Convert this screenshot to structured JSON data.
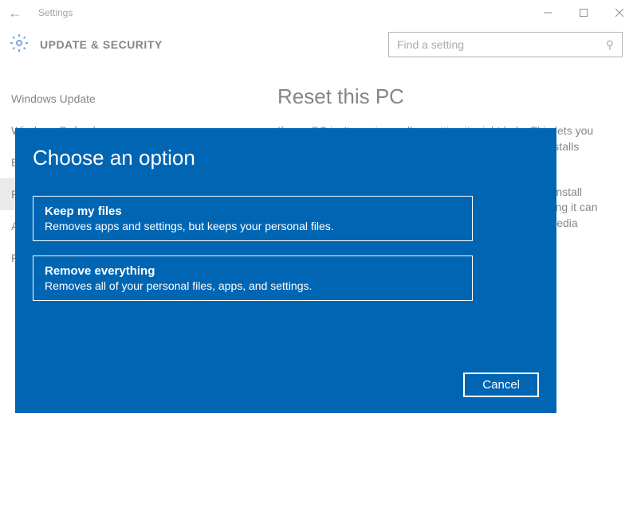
{
  "titlebar": {
    "title": "Settings"
  },
  "header": {
    "title": "UPDATE & SECURITY",
    "search_placeholder": "Find a setting"
  },
  "sidebar": {
    "items": [
      {
        "label": "Windows Update"
      },
      {
        "label": "Windows Defender"
      },
      {
        "label": "Backup"
      },
      {
        "label": "Recovery"
      },
      {
        "label": "Activation"
      },
      {
        "label": "For developers"
      }
    ]
  },
  "main": {
    "heading": "Reset this PC",
    "para1": "If your PC isn't running well, resetting it might help. This lets you choose to keep your files or remove them, and then reinstalls Windows.",
    "para2": "If you want to recycle your PC or start over with a clean install (using installation media like a disc or USB DVD), resetting it can help. You can change the startup settings to boot from media instead. This will"
  },
  "dialog": {
    "title": "Choose an option",
    "options": [
      {
        "title": "Keep my files",
        "desc": "Removes apps and settings, but keeps your personal files."
      },
      {
        "title": "Remove everything",
        "desc": "Removes all of your personal files, apps, and settings."
      }
    ],
    "cancel": "Cancel"
  }
}
